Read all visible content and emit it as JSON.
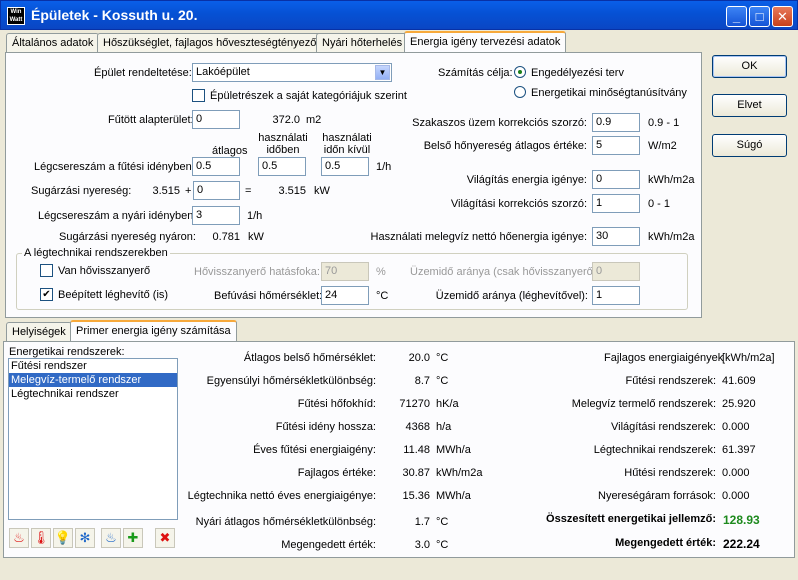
{
  "window": {
    "title": "Épületek - Kossuth u. 20.",
    "icon": "Win Watt",
    "minimize": "_",
    "maximize": "□",
    "close": "✕"
  },
  "tabs": [
    "Általános adatok",
    "Hőszükséglet, fajlagos hőveszteségtényező",
    "Nyári hőterhelés",
    "Energia igény tervezési adatok"
  ],
  "side_buttons": {
    "ok": "OK",
    "cancel": "Elvet",
    "help": "Súgó"
  },
  "form": {
    "building_use_label": "Épület rendeltetése:",
    "building_use_value": "Lakóépület",
    "subcategories_label": "Épületrészek a saját kategóriájuk szerint",
    "heated_area_label": "Fűtött alapterület:",
    "heated_area_input": "0",
    "heated_area_value": "372.0",
    "heated_area_unit": "m2",
    "col_avg": "átlagos",
    "col_in_use_1": "használati",
    "col_in_use_2": "időben",
    "col_out_use_1": "használati",
    "col_out_use_2": "időn kívül",
    "air_change_heating_label": "Légcsereszám a fűtési idényben:",
    "ach_avg": "0.5",
    "ach_in": "0.5",
    "ach_out": "0.5",
    "ach_unit": "1/h",
    "solar_gain_label": "Sugárzási nyereség:",
    "solar_gain_value": "3.515",
    "solar_plus": "+",
    "solar_gain_input": "0",
    "solar_eq": "=",
    "solar_total": "3.515",
    "solar_unit": "kW",
    "air_change_summer_label": "Légcsereszám a nyári idényben:",
    "ach_summer": "3",
    "ach_summer_unit": "1/h",
    "solar_summer_label": "Sugárzási nyereség nyáron:",
    "solar_summer_value": "0.781",
    "solar_summer_unit": "kW",
    "purpose_label": "Számítás célja:",
    "purpose_opt1": "Engedélyezési terv",
    "purpose_opt2": "Energetikai minőségtanúsítvány",
    "intermittent_label": "Szakaszos üzem korrekciós szorzó:",
    "intermittent_value": "0.9",
    "intermittent_range": "0.9 - 1",
    "internal_gain_label": "Belső hőnyereség átlagos értéke:",
    "internal_gain_value": "5",
    "internal_gain_unit": "W/m2",
    "lighting_label": "Világítás energia igénye:",
    "lighting_value": "0",
    "lighting_unit": "kWh/m2a",
    "lighting_corr_label": "Világítási korrekciós szorzó:",
    "lighting_corr_value": "1",
    "lighting_corr_range": "0 - 1",
    "dhw_label": "Használati melegvíz nettó hőenergia igénye:",
    "dhw_value": "30",
    "dhw_unit": "kWh/m2a",
    "vent_group_title": "A légtechnikai rendszerekben",
    "heat_recovery_label": "Van hővisszanyerő",
    "heat_recovery_eff_label": "Hővisszanyerő hatásfoka:",
    "heat_recovery_eff_value": "70",
    "heat_recovery_eff_unit": "%",
    "op_ratio_hr_label": "Üzemidő aránya (csak hővisszanyerő):",
    "op_ratio_hr_value": "0",
    "built_in_heater_label": "Beépített léghevítő (is)",
    "supply_temp_label": "Befúvási hőmérséklet:",
    "supply_temp_value": "24",
    "supply_temp_unit": "°C",
    "op_ratio_heater_label": "Üzemidő aránya (léghevítővel):",
    "op_ratio_heater_value": "1"
  },
  "bottom_tabs": [
    "Helyiségek",
    "Primer energia igény számítása"
  ],
  "systems": {
    "label": "Energetikai rendszerek:",
    "items": [
      "Fűtési rendszer",
      "Melegvíz-termelő rendszer",
      "Légtechnikai rendszer"
    ]
  },
  "results": [
    {
      "label": "Átlagos belső hőmérséklet:",
      "value": "20.0",
      "unit": "°C"
    },
    {
      "label": "Egyensúlyi hőmérsékletkülönbség:",
      "value": "8.7",
      "unit": "°C"
    },
    {
      "label": "Fűtési hőfokhíd:",
      "value": "71270",
      "unit": "hK/a"
    },
    {
      "label": "Fűtési idény hossza:",
      "value": "4368",
      "unit": "h/a"
    },
    {
      "label": "Éves fűtési energiaigény:",
      "value": "11.48",
      "unit": "MWh/a"
    },
    {
      "label": "Fajlagos értéke:",
      "value": "30.87",
      "unit": "kWh/m2a"
    },
    {
      "label": "Légtechnika nettó éves energiaigénye:",
      "value": "15.36",
      "unit": "MWh/a"
    },
    {
      "label": "Nyári átlagos hőmérsékletkülönbség:",
      "value": "1.7",
      "unit": "°C"
    },
    {
      "label": "Megengedett érték:",
      "value": "3.0",
      "unit": "°C"
    }
  ],
  "specific": {
    "header_label": "Fajlagos energiaigények",
    "header_unit": "[kWh/m2a]",
    "rows": [
      {
        "label": "Fűtési rendszerek:",
        "value": "41.609"
      },
      {
        "label": "Melegvíz termelő rendszerek:",
        "value": "25.920"
      },
      {
        "label": "Világítási rendszerek:",
        "value": "0.000"
      },
      {
        "label": "Légtechnikai rendszerek:",
        "value": "61.397"
      },
      {
        "label": "Hűtési rendszerek:",
        "value": "0.000"
      },
      {
        "label": "Nyereségáram források:",
        "value": "0.000"
      }
    ],
    "total_label": "Összesített energetikai jellemző:",
    "total_value": "128.93",
    "allowed_label": "Megengedett érték:",
    "allowed_value": "222.24"
  },
  "toolbar": {
    "heating": "♨",
    "dhw": "🌡",
    "lighting": "💡",
    "fan": "✻",
    "cooling": "♨",
    "add": "✚",
    "delete": "✖"
  },
  "colors": {
    "accent": "#316ac5",
    "total": "#1e8a1e",
    "tab_highlight": "#f7a93b"
  }
}
